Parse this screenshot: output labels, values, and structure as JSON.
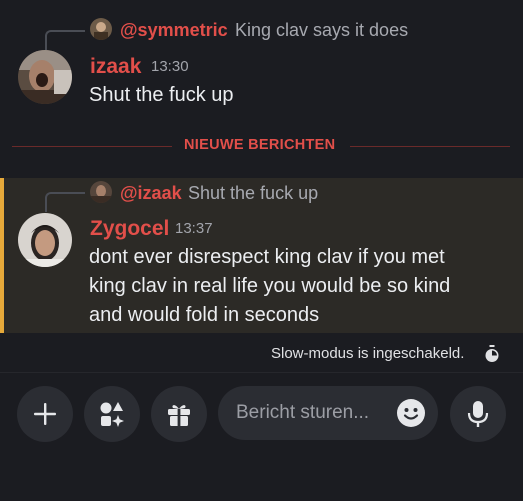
{
  "messages": [
    {
      "reply": {
        "name": "@symmetric",
        "text": "King clav says it does"
      },
      "author": "izaak",
      "time": "13:30",
      "lines": [
        "Shut the fuck up"
      ]
    },
    {
      "reply": {
        "name": "@izaak",
        "text": "Shut the fuck up"
      },
      "author": "Zygocel",
      "time": "13:37",
      "lines": [
        "dont ever disrespect king clav if you met",
        "king clav in real life you would be so kind",
        "and would fold in seconds"
      ]
    }
  ],
  "divider": {
    "label": "NIEUWE BERICHTEN"
  },
  "status": {
    "slowmode": "Slow-modus is ingeschakeld."
  },
  "composer": {
    "placeholder": "Bericht sturen..."
  },
  "colors": {
    "accent_name": "#e24f4a",
    "highlight_bar": "#e6a93a",
    "background": "#1b1c21"
  },
  "icons": [
    "plus-icon",
    "apps-icon",
    "gift-icon",
    "emoji-icon",
    "microphone-icon",
    "timer-icon"
  ]
}
